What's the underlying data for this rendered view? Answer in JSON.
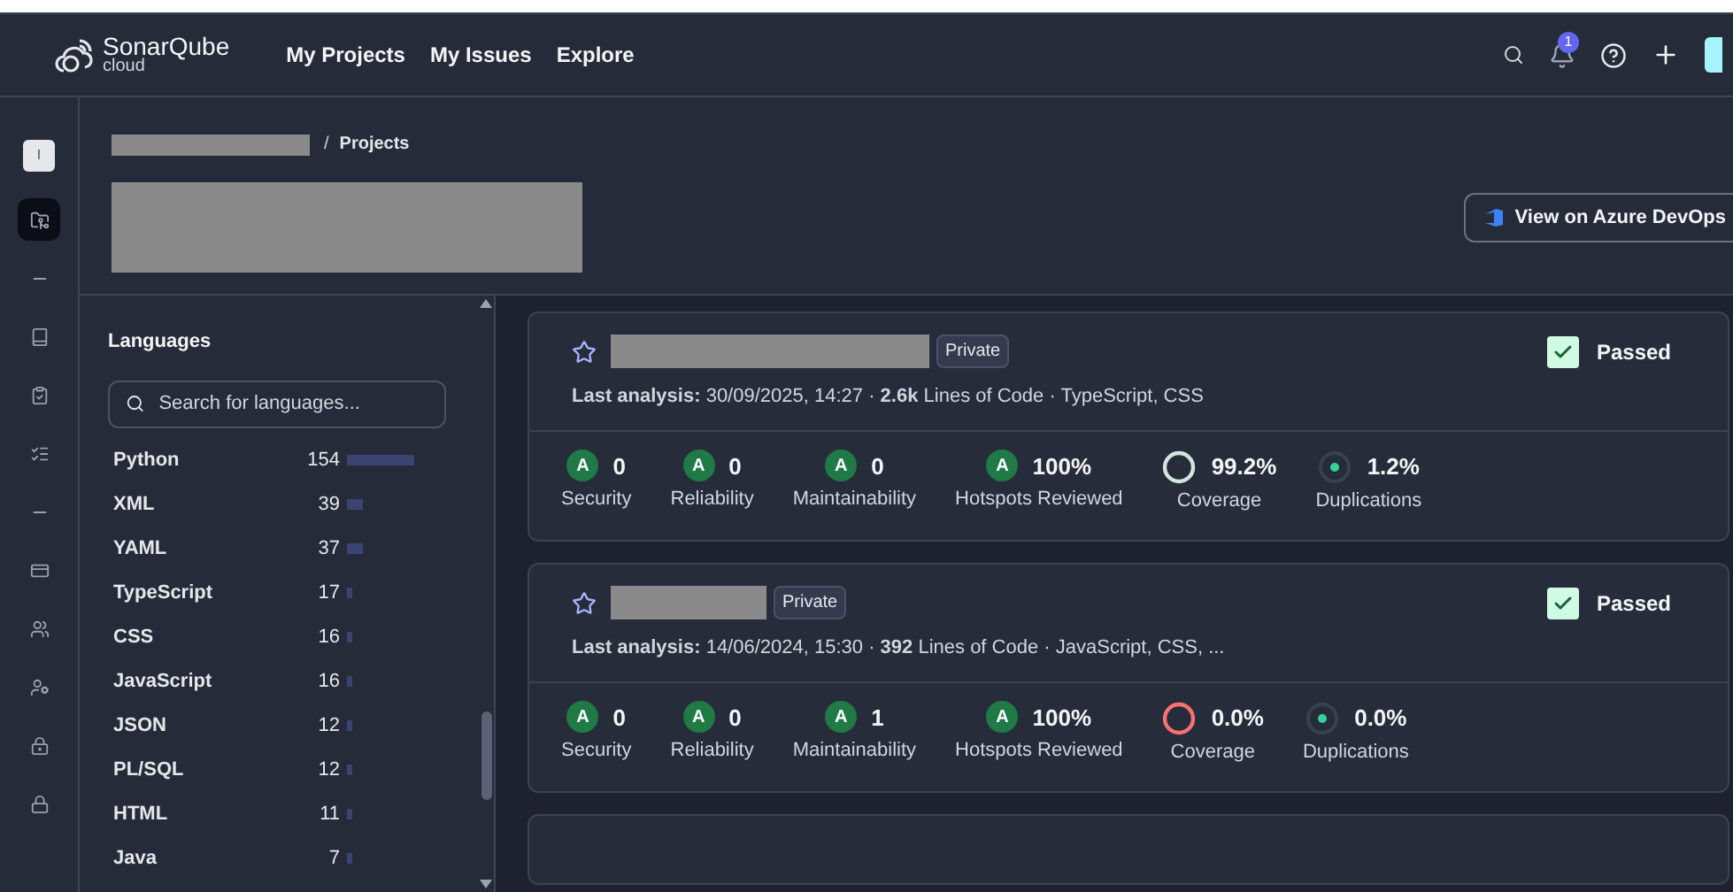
{
  "header": {
    "logo": {
      "name": "SonarQube",
      "sub": "cloud"
    },
    "nav": [
      {
        "label": "My Projects"
      },
      {
        "label": "My Issues"
      },
      {
        "label": "Explore"
      }
    ],
    "notification_count": "1"
  },
  "rail": {
    "org_initial": "I",
    "items": [
      {
        "selected": true
      },
      {
        "selected": false
      },
      {
        "selected": false
      },
      {
        "selected": false
      },
      {
        "selected": false
      },
      {
        "selected": false
      },
      {
        "selected": false
      },
      {
        "selected": false
      },
      {
        "selected": false
      },
      {
        "selected": false
      },
      {
        "selected": false
      }
    ]
  },
  "breadcrumb": {
    "separator": "/",
    "current": "Projects"
  },
  "action_button": {
    "label": "View on Azure DevOps"
  },
  "languages": {
    "title": "Languages",
    "search": {
      "placeholder": "Search for languages..."
    },
    "items": [
      {
        "name": "Python",
        "count": "154"
      },
      {
        "name": "XML",
        "count": "39"
      },
      {
        "name": "YAML",
        "count": "37"
      },
      {
        "name": "TypeScript",
        "count": "17"
      },
      {
        "name": "CSS",
        "count": "16"
      },
      {
        "name": "JavaScript",
        "count": "16"
      },
      {
        "name": "JSON",
        "count": "12"
      },
      {
        "name": "PL/SQL",
        "count": "12"
      },
      {
        "name": "HTML",
        "count": "11"
      },
      {
        "name": "Java",
        "count": "7"
      }
    ]
  },
  "projects": [
    {
      "visibility": "Private",
      "status": "Passed",
      "analysis": "**Last analysis:** 30/09/2025, 14:27 · **2.6k** Lines of Code · TypeScript, CSS",
      "metrics": [
        {
          "kind": "rating",
          "grade": "A",
          "value": "0",
          "label": "Security"
        },
        {
          "kind": "rating",
          "grade": "A",
          "value": "0",
          "label": "Reliability"
        },
        {
          "kind": "rating",
          "grade": "A",
          "value": "0",
          "label": "Maintainability"
        },
        {
          "kind": "rating",
          "grade": "A",
          "value": "100%",
          "label": "Hotspots Reviewed"
        },
        {
          "kind": "coverage",
          "value": "99.2%",
          "label": "Coverage",
          "color": "#d1e7dd"
        },
        {
          "kind": "duplication",
          "value": "1.2%",
          "label": "Duplications"
        }
      ]
    },
    {
      "visibility": "Private",
      "status": "Passed",
      "analysis": "**Last analysis:** 14/06/2024, 15:30 · **392** Lines of Code · JavaScript, CSS, ...",
      "metrics": [
        {
          "kind": "rating",
          "grade": "A",
          "value": "0",
          "label": "Security"
        },
        {
          "kind": "rating",
          "grade": "A",
          "value": "0",
          "label": "Reliability"
        },
        {
          "kind": "rating",
          "grade": "A",
          "value": "1",
          "label": "Maintainability"
        },
        {
          "kind": "rating",
          "grade": "A",
          "value": "100%",
          "label": "Hotspots Reviewed"
        },
        {
          "kind": "coverage",
          "value": "0.0%",
          "label": "Coverage",
          "color": "#f87171"
        },
        {
          "kind": "duplication",
          "value": "0.0%",
          "label": "Duplications"
        }
      ]
    }
  ]
}
